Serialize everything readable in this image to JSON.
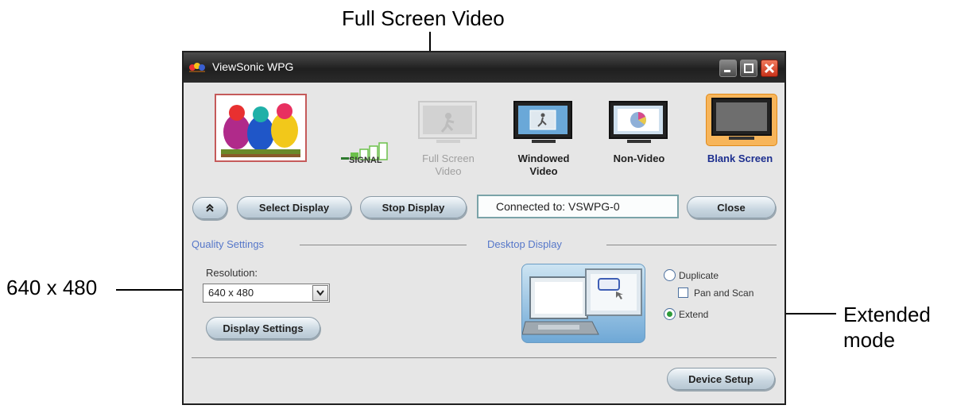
{
  "callouts": {
    "full_screen": "Full Screen Video",
    "resolution": "640 x 480",
    "extended_line1": "Extended",
    "extended_line2": "mode"
  },
  "window": {
    "title": "ViewSonic WPG"
  },
  "signal": {
    "label": "SIGNAL",
    "bars_lit": 2,
    "bars_total": 5
  },
  "modes": [
    {
      "line1": "Full Screen",
      "line2": "Video",
      "state": "disabled"
    },
    {
      "line1": "Windowed",
      "line2": "Video",
      "state": "enabled"
    },
    {
      "line1": "Non-Video",
      "line2": "",
      "state": "enabled"
    },
    {
      "line1": "Blank Screen",
      "line2": "",
      "state": "selected"
    }
  ],
  "toolbar": {
    "collapse_icon": "double-chevron-up-icon",
    "select_display": "Select Display",
    "stop_display": "Stop Display",
    "connected": "Connected to: VSWPG-0",
    "close": "Close"
  },
  "quality": {
    "title": "Quality Settings",
    "resolution_label": "Resolution:",
    "resolution_value": "640 x 480",
    "display_settings": "Display Settings"
  },
  "desktop": {
    "title": "Desktop Display",
    "duplicate": "Duplicate",
    "pan_scan": "Pan and Scan",
    "extend": "Extend",
    "selected": "Extend",
    "pan_scan_checked": false
  },
  "footer": {
    "device_setup": "Device Setup"
  },
  "colors": {
    "accent": "#5677c9",
    "selected_mode": "#1d2f8f",
    "disabled_text": "#a0a0a0",
    "radio_selected": "#2e9b3a",
    "window_close": "#d9461f"
  }
}
